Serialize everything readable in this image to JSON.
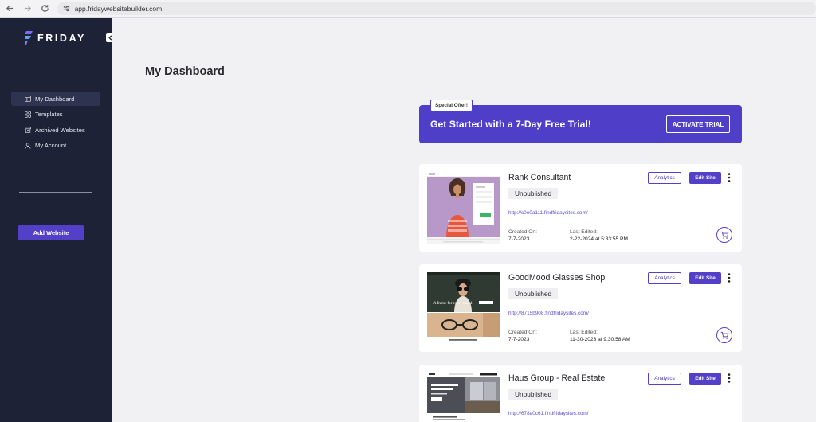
{
  "browser": {
    "url": "app.fridaywebsitebuilder.com"
  },
  "sidebar": {
    "logo_text": "FRIDAY",
    "items": [
      {
        "label": "My Dashboard",
        "icon": "dashboard-icon",
        "active": true
      },
      {
        "label": "Templates",
        "icon": "templates-icon",
        "active": false
      },
      {
        "label": "Archived Websites",
        "icon": "archive-icon",
        "active": false
      },
      {
        "label": "My Account",
        "icon": "user-icon",
        "active": false
      }
    ],
    "add_website_label": "Add Website"
  },
  "main": {
    "title": "My Dashboard",
    "promo": {
      "badge": "Special Offer!",
      "headline": "Get Started with a 7-Day Free Trial!",
      "button": "ACTIVATE TRIAL"
    },
    "labels": {
      "created": "Created On:",
      "edited": "Last Edited:",
      "analytics": "Analytics",
      "edit_site": "Edit Site"
    },
    "sites": [
      {
        "name": "Rank Consultant",
        "status": "Unpublished",
        "url": "http://c0e0a111.findfridaysites.com/",
        "created": "7-7-2023",
        "edited": "2-22-2024 at 5:33:55 PM"
      },
      {
        "name": "GoodMood Glasses Shop",
        "status": "Unpublished",
        "url": "http://8715b908.findfridaysites.com/",
        "created": "7-7-2023",
        "edited": "11-30-2023 at 9:30:58 AM",
        "thumb_text": "A frame for every mood"
      },
      {
        "name": "Haus Group - Real Estate",
        "status": "Unpublished",
        "url": "http://678a0c61.findfridaysites.com/"
      }
    ]
  },
  "colors": {
    "accent": "#5240c8",
    "sidebar": "#1e2237",
    "promo": "#4e3ec8"
  }
}
